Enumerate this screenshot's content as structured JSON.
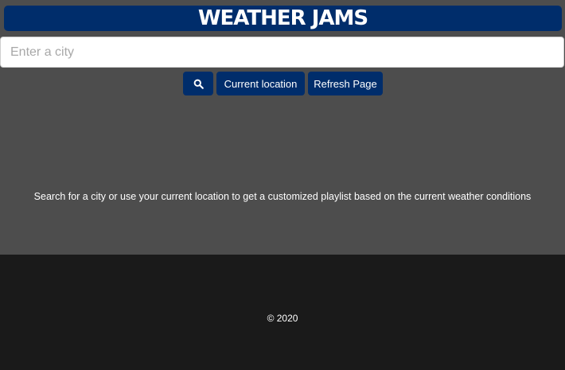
{
  "header": {
    "title": "WEATHER JAMS"
  },
  "search": {
    "placeholder": "Enter a city",
    "value": ""
  },
  "buttons": {
    "search_icon": "search-icon",
    "current_location_label": "Current location",
    "refresh_label": "Refresh Page"
  },
  "main": {
    "intro_text": "Search for a city or use your current location to get a customized playlist based on the current weather conditions"
  },
  "footer": {
    "copyright": "© 2020"
  },
  "colors": {
    "page_background": "#4d4d4d",
    "brand_navy": "#002d6b",
    "footer_background": "#1a1a1a",
    "text_light": "#ffffff"
  }
}
